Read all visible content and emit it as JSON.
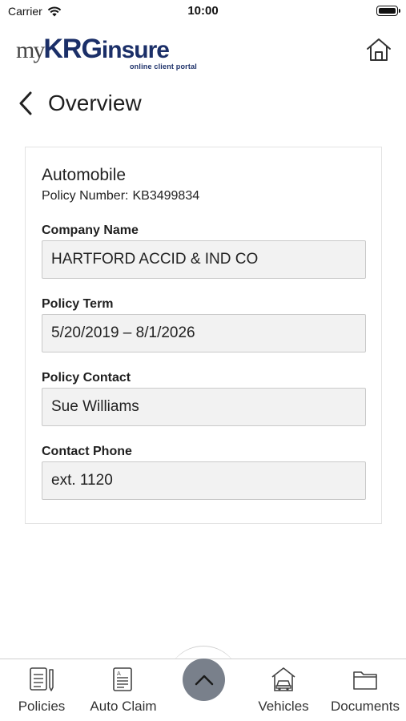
{
  "status_bar": {
    "carrier": "Carrier",
    "time": "10:00"
  },
  "header": {
    "logo": {
      "my": "my",
      "krg": "KRG",
      "insure": "insure",
      "tagline": "online client portal"
    },
    "home_icon": "home-icon"
  },
  "page": {
    "title": "Overview",
    "back_icon": "chevron-left-icon"
  },
  "policy": {
    "type": "Automobile",
    "number_label": "Policy Number:",
    "number": "KB3499834",
    "fields": [
      {
        "label": "Company Name",
        "value": "HARTFORD ACCID & IND CO"
      },
      {
        "label": "Policy Term",
        "value": "5/20/2019 – 8/1/2026"
      },
      {
        "label": "Policy Contact",
        "value": "Sue Williams"
      },
      {
        "label": "Contact Phone",
        "value": "ext. 1120"
      }
    ]
  },
  "tabbar": {
    "tabs": [
      {
        "label": "Policies",
        "icon": "policies-document-icon"
      },
      {
        "label": "Auto Claim",
        "icon": "auto-claim-form-icon"
      },
      {
        "label": "Vehicles",
        "icon": "vehicle-garage-icon"
      },
      {
        "label": "Documents",
        "icon": "folder-icon"
      }
    ],
    "center_button_icon": "chevron-up-icon"
  },
  "colors": {
    "brand_navy": "#1b2f68",
    "field_background": "#f2f2f2",
    "fab_background": "#79808b"
  }
}
